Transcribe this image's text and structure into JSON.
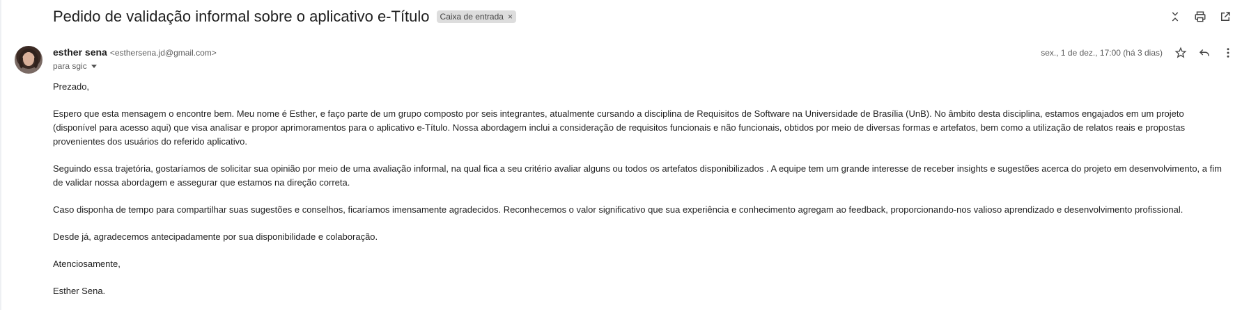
{
  "email": {
    "subject": "Pedido de validação informal sobre o aplicativo e-Título",
    "label": "Caixa de entrada",
    "label_remove": "×",
    "sender_name": "esther sena",
    "sender_email": "<esthersena.jd@gmail.com>",
    "to": "para sgic",
    "date": "sex., 1 de dez., 17:00 (há 3 dias)",
    "body": {
      "greeting": "Prezado,",
      "p1": "Espero que esta mensagem o encontre bem. Meu nome é Esther, e faço parte de um grupo composto por seis integrantes, atualmente cursando a disciplina de Requisitos de Software na Universidade de Brasília (UnB). No âmbito desta disciplina, estamos engajados em um projeto (disponível para acesso aqui) que visa analisar e propor aprimoramentos para o aplicativo e-Título. Nossa abordagem inclui a consideração de requisitos funcionais e não funcionais, obtidos por meio de diversas formas e artefatos, bem como a utilização de relatos reais e propostas provenientes dos usuários do referido aplicativo.",
      "p2": "Seguindo essa trajetória, gostaríamos de solicitar sua opinião por meio de uma avaliação informal, na qual fica a seu critério avaliar alguns ou todos os artefatos disponibilizados . A equipe tem um grande interesse de receber insights e sugestões acerca do projeto em desenvolvimento, a fim de validar nossa abordagem e assegurar que estamos na direção correta.",
      "p3": "Caso disponha de tempo para compartilhar suas sugestões e conselhos, ficaríamos imensamente agradecidos. Reconhecemos o valor significativo que sua experiência e conhecimento agregam ao feedback, proporcionando-nos valioso aprendizado e desenvolvimento profissional.",
      "p4": "Desde já, agradecemos antecipadamente por sua disponibilidade e colaboração.",
      "closing": "Atenciosamente,",
      "signature": "Esther Sena."
    }
  },
  "icons": {
    "collapse": "collapse-icon",
    "print": "print-icon",
    "open_new_window": "open-in-new-window-icon",
    "star": "star-icon",
    "reply": "reply-icon",
    "more": "more-vert-icon"
  }
}
